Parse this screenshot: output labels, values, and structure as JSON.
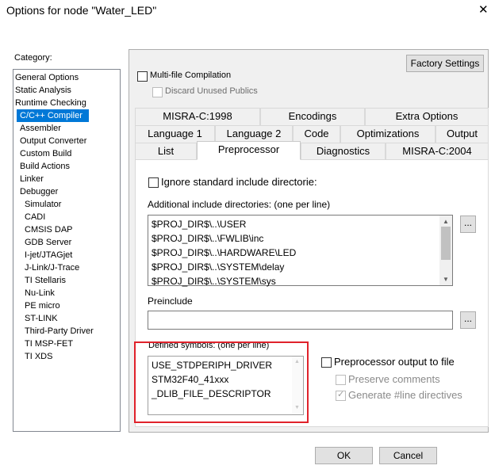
{
  "window": {
    "title": "Options for node \"Water_LED\"",
    "close_glyph": "✕"
  },
  "category": {
    "label": "Category:",
    "items": [
      {
        "label": "General Options",
        "indent": 0,
        "selected": false
      },
      {
        "label": "Static Analysis",
        "indent": 0,
        "selected": false
      },
      {
        "label": "Runtime Checking",
        "indent": 0,
        "selected": false
      },
      {
        "label": "C/C++ Compiler",
        "indent": 1,
        "selected": true
      },
      {
        "label": "Assembler",
        "indent": 1,
        "selected": false
      },
      {
        "label": "Output Converter",
        "indent": 1,
        "selected": false
      },
      {
        "label": "Custom Build",
        "indent": 1,
        "selected": false
      },
      {
        "label": "Build Actions",
        "indent": 1,
        "selected": false
      },
      {
        "label": "Linker",
        "indent": 1,
        "selected": false
      },
      {
        "label": "Debugger",
        "indent": 1,
        "selected": false
      },
      {
        "label": "Simulator",
        "indent": 2,
        "selected": false
      },
      {
        "label": "CADI",
        "indent": 2,
        "selected": false
      },
      {
        "label": "CMSIS DAP",
        "indent": 2,
        "selected": false
      },
      {
        "label": "GDB Server",
        "indent": 2,
        "selected": false
      },
      {
        "label": "I-jet/JTAGjet",
        "indent": 2,
        "selected": false
      },
      {
        "label": "J-Link/J-Trace",
        "indent": 2,
        "selected": false
      },
      {
        "label": "TI Stellaris",
        "indent": 2,
        "selected": false
      },
      {
        "label": "Nu-Link",
        "indent": 2,
        "selected": false
      },
      {
        "label": "PE micro",
        "indent": 2,
        "selected": false
      },
      {
        "label": "ST-LINK",
        "indent": 2,
        "selected": false
      },
      {
        "label": "Third-Party Driver",
        "indent": 2,
        "selected": false
      },
      {
        "label": "TI MSP-FET",
        "indent": 2,
        "selected": false
      },
      {
        "label": "TI XDS",
        "indent": 2,
        "selected": false
      }
    ]
  },
  "factory_settings_label": "Factory Settings",
  "multifile": {
    "label": "Multi-file Compilation",
    "checked": false
  },
  "discard": {
    "label": "Discard Unused Publics",
    "checked": false
  },
  "tabs": {
    "row1": [
      "MISRA-C:1998",
      "Encodings",
      "Extra Options"
    ],
    "row2": [
      "Language 1",
      "Language 2",
      "Code",
      "Optimizations",
      "Output"
    ],
    "row3": [
      "List",
      "Preprocessor",
      "Diagnostics",
      "MISRA-C:2004"
    ],
    "active": "Preprocessor"
  },
  "preprocessor": {
    "ignore_std": {
      "label": "Ignore standard include directorie:",
      "checked": false
    },
    "include_dirs_label": "Additional include directories: (one per line)",
    "include_dirs": [
      "$PROJ_DIR$\\..\\USER",
      "$PROJ_DIR$\\..\\FWLIB\\inc",
      "$PROJ_DIR$\\..\\HARDWARE\\LED",
      "$PROJ_DIR$\\..\\SYSTEM\\delay",
      "$PROJ_DIR$\\..\\SYSTEM\\sys"
    ],
    "browse_label": "...",
    "preinclude_label": "Preinclude",
    "preinclude_value": "",
    "defined_label": "Defined symbols: (one per line)",
    "defined_symbols": [
      "USE_STDPERIPH_DRIVER",
      "STM32F40_41xxx",
      "_DLIB_FILE_DESCRIPTOR"
    ],
    "pp_output": {
      "label": "Preprocessor output to file",
      "checked": false
    },
    "preserve": {
      "label": "Preserve comments",
      "checked": false
    },
    "line_directives": {
      "label": "Generate #line directives",
      "checked": true
    }
  },
  "ok_label": "OK",
  "cancel_label": "Cancel",
  "highlight_color": "#e0222b",
  "selection_color": "#0078d7"
}
